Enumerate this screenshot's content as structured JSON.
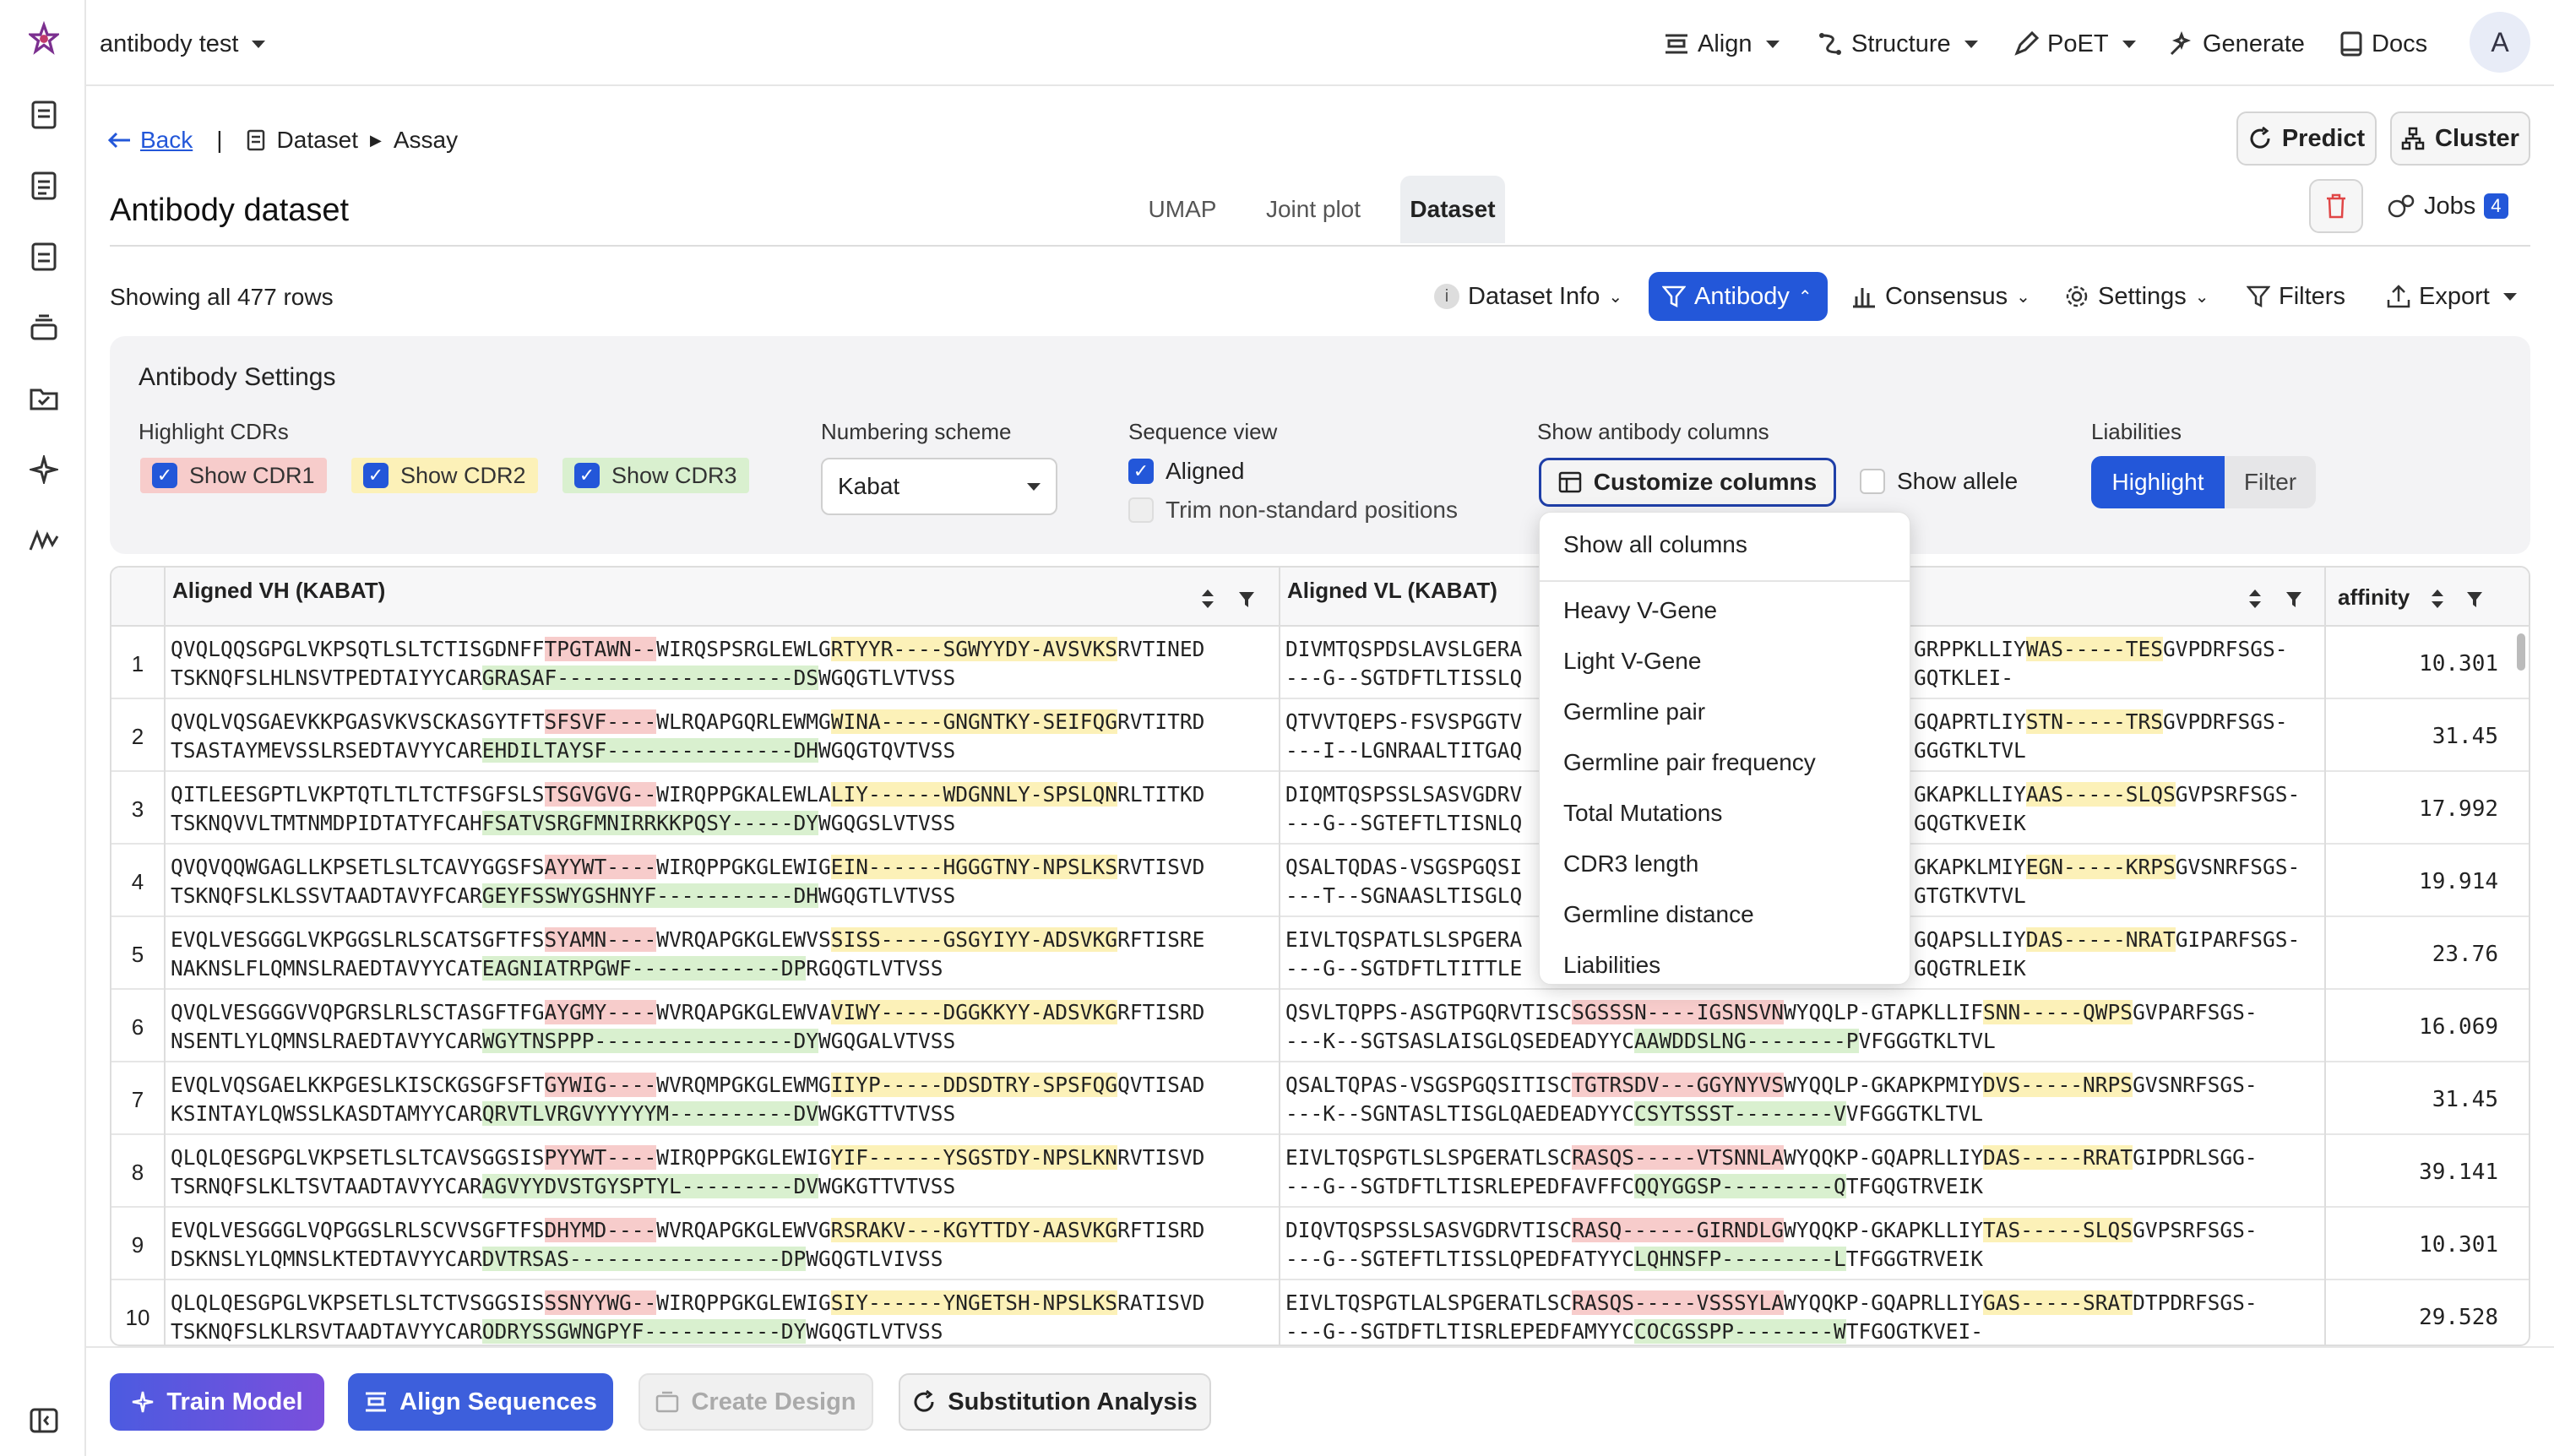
{
  "header": {
    "project": "antibody test",
    "nav": {
      "align": "Align",
      "structure": "Structure",
      "poet": "PoET",
      "generate": "Generate",
      "docs": "Docs"
    },
    "avatar": "A"
  },
  "breadcrumb": {
    "back": "Back",
    "sep": "|",
    "dataset": "Dataset",
    "assay": "Assay"
  },
  "page": {
    "title": "Antibody dataset",
    "predict": "Predict",
    "cluster": "Cluster",
    "jobs": "Jobs",
    "jobs_count": "4"
  },
  "tabs": {
    "umap": "UMAP",
    "joint": "Joint plot",
    "dataset": "Dataset"
  },
  "toolbar": {
    "rows": "Showing all 477 rows",
    "info": "Dataset Info",
    "antibody": "Antibody",
    "consensus": "Consensus",
    "settings": "Settings",
    "filters": "Filters",
    "export": "Export"
  },
  "settings": {
    "title": "Antibody Settings",
    "highlight_label": "Highlight CDRs",
    "cdr1": "Show CDR1",
    "cdr2": "Show CDR2",
    "cdr3": "Show CDR3",
    "numbering_label": "Numbering scheme",
    "numbering_value": "Kabat",
    "seqview_label": "Sequence view",
    "aligned": "Aligned",
    "trim": "Trim non-standard positions",
    "columns_label": "Show antibody columns",
    "customize": "Customize columns",
    "allele": "Show allele",
    "liab_label": "Liabilities",
    "highlight": "Highlight",
    "filter": "Filter"
  },
  "dropdown": {
    "show_all": "Show all columns",
    "items": [
      "Heavy V-Gene",
      "Light V-Gene",
      "Germline pair",
      "Germline pair frequency",
      "Total Mutations",
      "CDR3 length",
      "Germline distance",
      "Liabilities"
    ]
  },
  "table": {
    "col_vh": "Aligned VH (KABAT)",
    "col_vl": "Aligned VL (KABAT)",
    "col_aff": "affinity",
    "rows": [
      {
        "n": "1",
        "aff": "10.301",
        "vh": [
          [
            [
              "QVQLQQSGPGLVKPSQTLSLTCTISGDNFF",
              ""
            ],
            [
              "TPGTAWN--",
              "c1"
            ],
            [
              "WIRQSPSRGLEWLG",
              ""
            ],
            [
              "RTYYR----SGWYYDY-AVSVKS",
              "c2"
            ],
            [
              "RVTINED",
              ""
            ]
          ],
          [
            [
              "TSKNQFSLHLNSVTPEDTAIYYCAR",
              ""
            ],
            [
              "GRASAF-------------------DS",
              "c3"
            ],
            [
              "WGQGTLVTVSS",
              ""
            ]
          ]
        ],
        "vl": [
          [
            [
              "DIVMTQSPDSLAVSLGERA",
              ""
            ]
          ],
          [
            [
              "---G--SGTDFTLTISSLQ",
              ""
            ]
          ]
        ],
        "vr": [
          [
            [
              "GRPPKLLIY",
              ""
            ],
            [
              "WAS-----TES",
              "c2"
            ],
            [
              "GVPDRFSGS-",
              ""
            ]
          ],
          [
            [
              "GQTKLEI-",
              ""
            ]
          ]
        ]
      },
      {
        "n": "2",
        "aff": "31.45",
        "vh": [
          [
            [
              "QVQLVQSGAEVKKPGASVKVSCKASGYTFT",
              ""
            ],
            [
              "SFSVF----",
              "c1"
            ],
            [
              "WLRQAPGQRLEWMG",
              ""
            ],
            [
              "WINA-----GNGNTKY-SEIFQG",
              "c2"
            ],
            [
              "RVTITRD",
              ""
            ]
          ],
          [
            [
              "TSASTAYMEVSSLRSEDTAVYYCAR",
              ""
            ],
            [
              "EHDILTAYSF---------------DH",
              "c3"
            ],
            [
              "WGQGTQVTVSS",
              ""
            ]
          ]
        ],
        "vl": [
          [
            [
              "QTVVTQEPS-FSVSPGGTV",
              ""
            ]
          ],
          [
            [
              "---I--LGNRAALTITGAQ",
              ""
            ]
          ]
        ],
        "vr": [
          [
            [
              "GQAPRTLIY",
              ""
            ],
            [
              "STN-----TRS",
              "c2"
            ],
            [
              "GVPDRFSGS-",
              ""
            ]
          ],
          [
            [
              "GGGTKLTVL",
              ""
            ]
          ]
        ]
      },
      {
        "n": "3",
        "aff": "17.992",
        "vh": [
          [
            [
              "QITLEESGPTLVKPTQTLTLTCTFSGFSLS",
              ""
            ],
            [
              "TSGVGVG--",
              "c1"
            ],
            [
              "WIRQPPGKALEWLA",
              ""
            ],
            [
              "LIY------WDGNNLY-SPSLQN",
              "c2"
            ],
            [
              "RLTITKD",
              ""
            ]
          ],
          [
            [
              "TSKNQVVLTMTNMDPIDTATYFCAH",
              ""
            ],
            [
              "FSATVSRGFMNIRRKKPQSY-----DY",
              "c3"
            ],
            [
              "WGQGSLVTVSS",
              ""
            ]
          ]
        ],
        "vl": [
          [
            [
              "DIQMTQSPSSLSASVGDRV",
              ""
            ]
          ],
          [
            [
              "---G--SGTEFTLTISNLQ",
              ""
            ]
          ]
        ],
        "vr": [
          [
            [
              "GKAPKLLIY",
              ""
            ],
            [
              "AAS-----SLQS",
              "c2"
            ],
            [
              "GVPSRFSGS-",
              ""
            ]
          ],
          [
            [
              "GQGTKVEIK",
              ""
            ]
          ]
        ]
      },
      {
        "n": "4",
        "aff": "19.914",
        "vh": [
          [
            [
              "QVQVQQWGAGLLKPSETLSLTCAVYGGSFS",
              ""
            ],
            [
              "AYYWT----",
              "c1"
            ],
            [
              "WIRQPPGKGLEWIG",
              ""
            ],
            [
              "EIN------HGGGTNY-NPSLKS",
              "c2"
            ],
            [
              "RVTISVD",
              ""
            ]
          ],
          [
            [
              "TSKNQFSLKLSSVTAADTAVYFCAR",
              ""
            ],
            [
              "GEYFSSWYGSHNYF-----------DH",
              "c3"
            ],
            [
              "WGQGTLVTVSS",
              ""
            ]
          ]
        ],
        "vl": [
          [
            [
              "QSALTQDAS-VSGSPGQSI",
              ""
            ]
          ],
          [
            [
              "---T--SGNAASLTISGLQ",
              ""
            ]
          ]
        ],
        "vr": [
          [
            [
              "GKAPKLMIY",
              ""
            ],
            [
              "EGN-----KRPS",
              "c2"
            ],
            [
              "GVSNRFSGS-",
              ""
            ]
          ],
          [
            [
              "GTGTKVTVL",
              ""
            ]
          ]
        ]
      },
      {
        "n": "5",
        "aff": "23.76",
        "vh": [
          [
            [
              "EVQLVESGGGLVKPGGSLRLSCATSGFTFS",
              ""
            ],
            [
              "SYAMN----",
              "c1"
            ],
            [
              "WVRQAPGKGLEWVS",
              ""
            ],
            [
              "SISS-----GSGYIYY-ADSVKG",
              "c2"
            ],
            [
              "RFTISRE",
              ""
            ]
          ],
          [
            [
              "NAKNSLFLQMNSLRAEDTAVYYCAT",
              ""
            ],
            [
              "EAGNIATRPGWF------------DP",
              "c3"
            ],
            [
              "RGQGTLVTVSS",
              ""
            ]
          ]
        ],
        "vl": [
          [
            [
              "EIVLTQSPATLSLSPGERA",
              ""
            ]
          ],
          [
            [
              "---G--SGTDFTLTITTLE",
              ""
            ]
          ]
        ],
        "vr": [
          [
            [
              "GQAPSLLIY",
              ""
            ],
            [
              "DAS-----NRAT",
              "c2"
            ],
            [
              "GIPARFSGS-",
              ""
            ]
          ],
          [
            [
              "GQGTRLEIK",
              ""
            ]
          ]
        ]
      },
      {
        "n": "6",
        "aff": "16.069",
        "vh": [
          [
            [
              "QVQLVESGGGVVQPGRSLRLSCTASGFTFG",
              ""
            ],
            [
              "AYGMY----",
              "c1"
            ],
            [
              "WVRQAPGKGLEWVA",
              ""
            ],
            [
              "VIWY-----DGGKKYY-ADSVKG",
              "c2"
            ],
            [
              "RFTISRD",
              ""
            ]
          ],
          [
            [
              "NSENTLYLQMNSLRAEDTAVYYCAR",
              ""
            ],
            [
              "WGYTNSPPP----------------DY",
              "c3"
            ],
            [
              "WGQGALVTVSS",
              ""
            ]
          ]
        ],
        "vl": [
          [
            [
              "QSVLTQPPS-ASGTPGQRVTISC",
              ""
            ],
            [
              "SGSSSN----IGSNSVN",
              "c1"
            ],
            [
              "WYQQLP-GTAPKLLIF",
              ""
            ],
            [
              "SNN-----QWPS",
              "c2"
            ],
            [
              "GVPARFSGS-",
              ""
            ]
          ],
          [
            [
              "---K--SGTSASLAISGLQSEDEADYYC",
              ""
            ],
            [
              "AAWDDSLNG--------P",
              "c3"
            ],
            [
              "VFGGGTKLTVL",
              ""
            ]
          ]
        ],
        "vr": []
      },
      {
        "n": "7",
        "aff": "31.45",
        "vh": [
          [
            [
              "EVQLVQSGAELKKPGESLKISCKGSGFSFT",
              ""
            ],
            [
              "GYWIG----",
              "c1"
            ],
            [
              "WVRQMPGKGLEWMG",
              ""
            ],
            [
              "IIYP-----DDSDTRY-SPSFQG",
              "c2"
            ],
            [
              "QVTISAD",
              ""
            ]
          ],
          [
            [
              "KSINTAYLQWSSLKASDTAMYYCAR",
              ""
            ],
            [
              "QRVTLVRGVYYYYYM----------DV",
              "c3"
            ],
            [
              "WGKGTTVTVSS",
              ""
            ]
          ]
        ],
        "vl": [
          [
            [
              "QSALTQPAS-VSGSPGQSITISC",
              ""
            ],
            [
              "TGTRSDV---GGYNYVS",
              "c1"
            ],
            [
              "WYQQLP-GKAPKPMIY",
              ""
            ],
            [
              "DVS-----NRPS",
              "c2"
            ],
            [
              "GVSNRFSGS-",
              ""
            ]
          ],
          [
            [
              "---K--SGNTASLTISGLQAEDEADYYC",
              ""
            ],
            [
              "CSYTSSST--------V",
              "c3"
            ],
            [
              "VFGGGTKLTVL",
              ""
            ]
          ]
        ],
        "vr": []
      },
      {
        "n": "8",
        "aff": "39.141",
        "vh": [
          [
            [
              "QLQLQESGPGLVKPSETLSLTCAVSGGSIS",
              ""
            ],
            [
              "PYYWT----",
              "c1"
            ],
            [
              "WIRQPPGKGLEWIG",
              ""
            ],
            [
              "YIF------YSGSTDY-NPSLKN",
              "c2"
            ],
            [
              "RVTISVD",
              ""
            ]
          ],
          [
            [
              "TSRNQFSLKLTSVTAADTAVYYCAR",
              ""
            ],
            [
              "AGVYYDVSTGYSPTYL---------DV",
              "c3"
            ],
            [
              "WGKGTTVTVSS",
              ""
            ]
          ]
        ],
        "vl": [
          [
            [
              "EIVLTQSPGTLSLSPGERATLSC",
              ""
            ],
            [
              "RASQS-----VTSNNLA",
              "c1"
            ],
            [
              "WYQQKP-GQAPRLLIY",
              ""
            ],
            [
              "DAS-----RRAT",
              "c2"
            ],
            [
              "GIPDRLSGG-",
              ""
            ]
          ],
          [
            [
              "---G--SGTDFTLTISRLEPEDFAVFFC",
              ""
            ],
            [
              "QQYGGSP---------Q",
              "c3"
            ],
            [
              "TFGQGTRVEIK",
              ""
            ]
          ]
        ],
        "vr": []
      },
      {
        "n": "9",
        "aff": "10.301",
        "vh": [
          [
            [
              "EVQLVESGGGLVQPGGSLRLSCVVSGFTFS",
              ""
            ],
            [
              "DHYMD----",
              "c1"
            ],
            [
              "WVRQAPGKGLEWVG",
              ""
            ],
            [
              "RSRAKV---KGYTTDY-AASVKG",
              "c2"
            ],
            [
              "RFTISRD",
              ""
            ]
          ],
          [
            [
              "DSKNSLYLQMNSLKTEDTAVYYCAR",
              ""
            ],
            [
              "DVTRSAS-----------------DP",
              "c3"
            ],
            [
              "WGQGTLVIVSS",
              ""
            ]
          ]
        ],
        "vl": [
          [
            [
              "DIQVTQSPSSLSASVGDRVTISC",
              ""
            ],
            [
              "RASQ------GIRNDLG",
              "c1"
            ],
            [
              "WYQQKP-GKAPKLLIY",
              ""
            ],
            [
              "TAS-----SLQS",
              "c2"
            ],
            [
              "GVPSRFSGS-",
              ""
            ]
          ],
          [
            [
              "---G--SGTEFTLTISSLQPEDFATYYC",
              ""
            ],
            [
              "LQHNSFP---------L",
              "c3"
            ],
            [
              "TFGGGTRVEIK",
              ""
            ]
          ]
        ],
        "vr": []
      },
      {
        "n": "10",
        "aff": "29.528",
        "vh": [
          [
            [
              "QLQLQESGPGLVKPSETLSLTCTVSGGSIS",
              ""
            ],
            [
              "SSNYYWG--",
              "c1"
            ],
            [
              "WIRQPPGKGLEWIG",
              ""
            ],
            [
              "SIY------YNGETSH-NPSLKS",
              "c2"
            ],
            [
              "RATISVD",
              ""
            ]
          ],
          [
            [
              "TSKNQFSLKLRSVTAADTAVYYCAR",
              ""
            ],
            [
              "ODRYSSGWNGPYF-----------DY",
              "c3"
            ],
            [
              "WGQGTLVTVSS",
              ""
            ]
          ]
        ],
        "vl": [
          [
            [
              "EIVLTQSPGTLALSPGERATLSC",
              ""
            ],
            [
              "RASQS-----VSSSYLA",
              "c1"
            ],
            [
              "WYQQKP-GQAPRLLIY",
              ""
            ],
            [
              "GAS-----SRAT",
              "c2"
            ],
            [
              "DTPDRFSGS-",
              ""
            ]
          ],
          [
            [
              "---G--SGTDFTLTISRLEPEDFAMYYC",
              ""
            ],
            [
              "COCGSSPP--------W",
              "c3"
            ],
            [
              "TFGOGTKVEI-",
              ""
            ]
          ]
        ],
        "vr": []
      }
    ]
  },
  "bottom": {
    "train": "Train Model",
    "align": "Align Sequences",
    "design": "Create Design",
    "subst": "Substitution Analysis"
  },
  "colors": {
    "accent": "#2357d9",
    "purple": "#6a4ce0",
    "cdr1": "#f7cccb",
    "cdr2": "#fcf1b8",
    "cdr3": "#d9f0cf"
  }
}
